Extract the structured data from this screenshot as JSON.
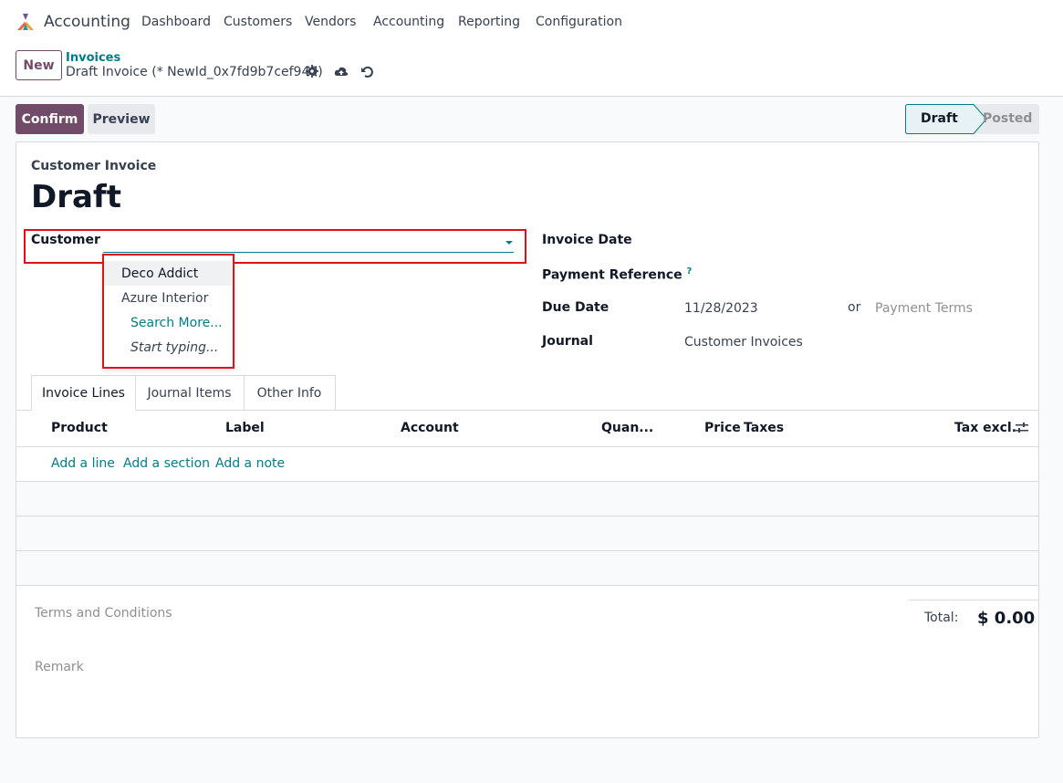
{
  "navbar": {
    "app_title": "Accounting",
    "menu": [
      "Dashboard",
      "Customers",
      "Vendors",
      "Accounting",
      "Reporting",
      "Configuration"
    ]
  },
  "control_panel": {
    "new_label": "New",
    "breadcrumb": "Invoices",
    "record_title": "Draft Invoice (* NewId_0x7fd9b7cef940)",
    "icons": [
      "gear-icon",
      "cloud-upload-icon",
      "undo-icon"
    ]
  },
  "actions": {
    "confirm_label": "Confirm",
    "preview_label": "Preview"
  },
  "status": {
    "draft": "Draft",
    "posted": "Posted",
    "active": "Draft"
  },
  "form": {
    "subtitle": "Customer Invoice",
    "title": "Draft",
    "customer_label": "Customer",
    "customer_value": "",
    "invoice_date_label": "Invoice Date",
    "payment_reference_label": "Payment Reference",
    "payment_reference_help": "?",
    "due_date_label": "Due Date",
    "due_date_value": "11/28/2023",
    "or_text": "or",
    "payment_terms_placeholder": "Payment Terms",
    "journal_label": "Journal",
    "journal_value": "Customer Invoices"
  },
  "dropdown": {
    "items": [
      "Deco Addict",
      "Azure Interior"
    ],
    "search_more": "Search More...",
    "start_typing": "Start typing..."
  },
  "tabs": [
    "Invoice Lines",
    "Journal Items",
    "Other Info"
  ],
  "table": {
    "headers": [
      "Product",
      "Label",
      "Account",
      "Quan...",
      "Price",
      "Taxes",
      "Tax excl."
    ],
    "add_line": "Add a line",
    "add_section": "Add a section",
    "add_note": "Add a note"
  },
  "footer": {
    "terms_placeholder": "Terms and Conditions",
    "remark_placeholder": "Remark",
    "total_label": "Total:",
    "total_value": "$ 0.00"
  },
  "colors": {
    "brand": "#714b67",
    "accent": "#017e84",
    "highlight": "#e0101a"
  }
}
